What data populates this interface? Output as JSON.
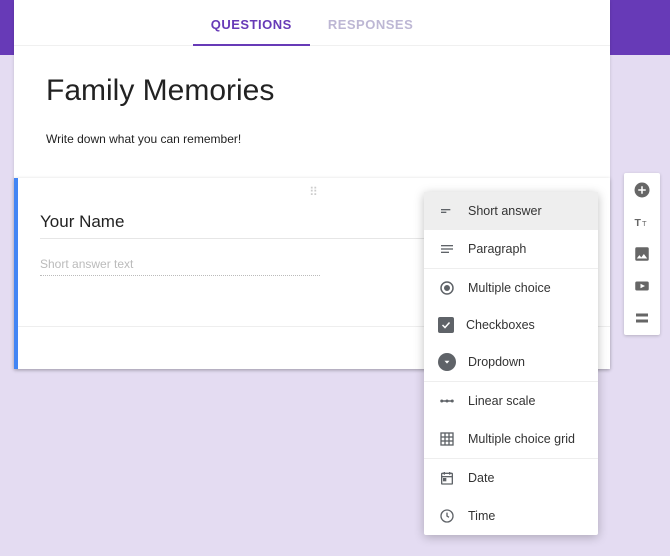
{
  "tabs": {
    "questions": "QUESTIONS",
    "responses": "RESPONSES"
  },
  "form": {
    "title": "Family Memories",
    "description": "Write down what you can remember!"
  },
  "question": {
    "title": "Your Name",
    "answer_placeholder": "Short answer text"
  },
  "type_menu": {
    "short_answer": "Short answer",
    "paragraph": "Paragraph",
    "multiple_choice": "Multiple choice",
    "checkboxes": "Checkboxes",
    "dropdown": "Dropdown",
    "linear_scale": "Linear scale",
    "multiple_choice_grid": "Multiple choice grid",
    "date": "Date",
    "time": "Time"
  }
}
